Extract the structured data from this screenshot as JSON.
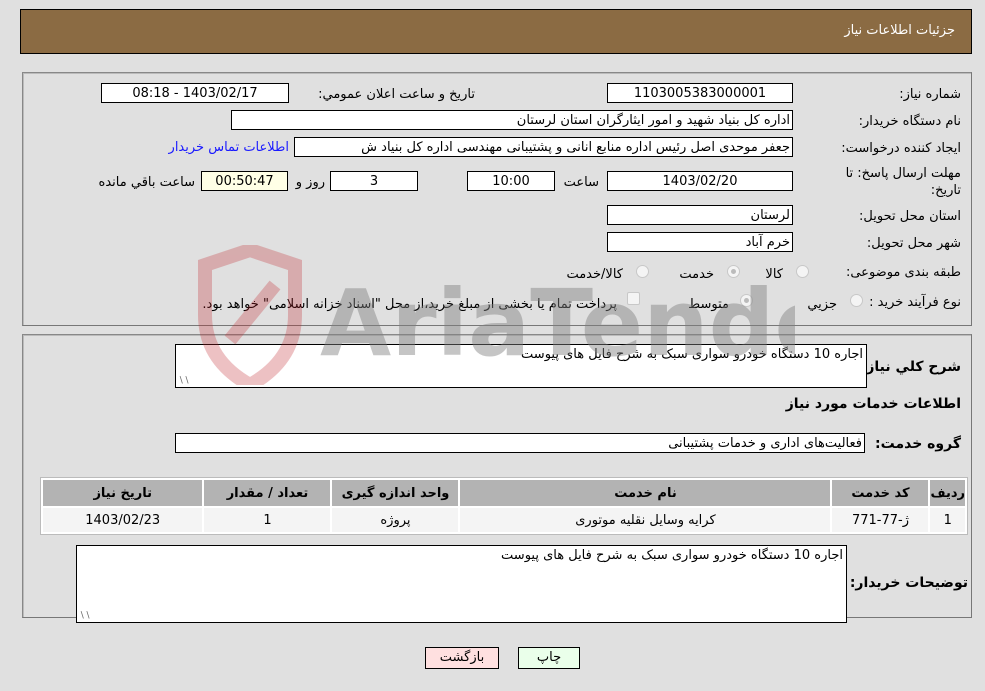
{
  "header": {
    "title": "جزئیات اطلاعات نیاز"
  },
  "form": {
    "need_number": {
      "label": "شماره نیاز:",
      "value": "1103005383000001"
    },
    "announce_datetime": {
      "label": "تاریخ و ساعت اعلان عمومي:",
      "value": "1403/02/17 - 08:18"
    },
    "buyer_org": {
      "label": "نام دستگاه خريدار:",
      "value": "اداره کل بنیاد شهید و امور ایثارگران استان لرستان"
    },
    "requester": {
      "label": "ایجاد کننده درخواست:",
      "value": "جعفر موحدی اصل رئیس اداره منابع انانی و پشتیبانی مهندسی اداره کل بنیاد ش"
    },
    "contact_link": "اطلاعات تماس خریدار",
    "deadline": {
      "label": "مهلت ارسال پاسخ: تا تاریخ:",
      "date": "1403/02/20",
      "time_label": "ساعت",
      "time": "10:00",
      "days": "3",
      "days_label": "روز و",
      "remaining": "00:50:47",
      "remaining_label": "ساعت باقي مانده"
    },
    "province": {
      "label": "استان محل تحویل:",
      "value": "لرستان"
    },
    "city": {
      "label": "شهر محل تحویل:",
      "value": "خرم آباد"
    },
    "category": {
      "label": "طبقه بندی موضوعی:",
      "options": [
        "کالا",
        "خدمت",
        "کالا/خدمت"
      ],
      "selected": "خدمت"
    },
    "purchase_type": {
      "label": "نوع فرآیند خرید :",
      "options": [
        "جزيي",
        "متوسط"
      ],
      "selected": "متوسط",
      "treasury_note": "پرداخت تمام یا بخشی از مبلغ خرید،از محل \"اسناد خزانه اسلامی\" خواهد بود."
    }
  },
  "details": {
    "summary_label": "شرح كلي نياز:",
    "summary_value": "اجاره 10 دستگاه خودرو سواری سبک به شرح فایل های پیوست",
    "services_heading": "اطلاعات خدمات مورد نیاز",
    "service_group_label": "گروه خدمت:",
    "service_group_value": "فعالیت‌های اداری و خدمات پشتیبانی",
    "table": {
      "headers": [
        "ردیف",
        "کد خدمت",
        "نام خدمت",
        "واحد اندازه گیری",
        "تعداد / مقدار",
        "تاریخ نیاز"
      ],
      "rows": [
        [
          "1",
          "ژ-77-771",
          "کرایه وسایل نقلیه موتوری",
          "پروژه",
          "1",
          "1403/02/23"
        ]
      ]
    },
    "buyer_notes_label": "توضیحات خریدار:",
    "buyer_notes_value": "اجاره 10 دستگاه خودرو سواری سبک به شرح فایل های پیوست"
  },
  "buttons": {
    "print": "چاپ",
    "back": "بازگشت"
  },
  "watermark": {
    "text": "AriaTender.neT"
  },
  "colors": {
    "header_bg": "#8b6b43",
    "print_bg": "#eaffea",
    "back_bg": "#ffe0e0",
    "link": "#1a1aff"
  }
}
